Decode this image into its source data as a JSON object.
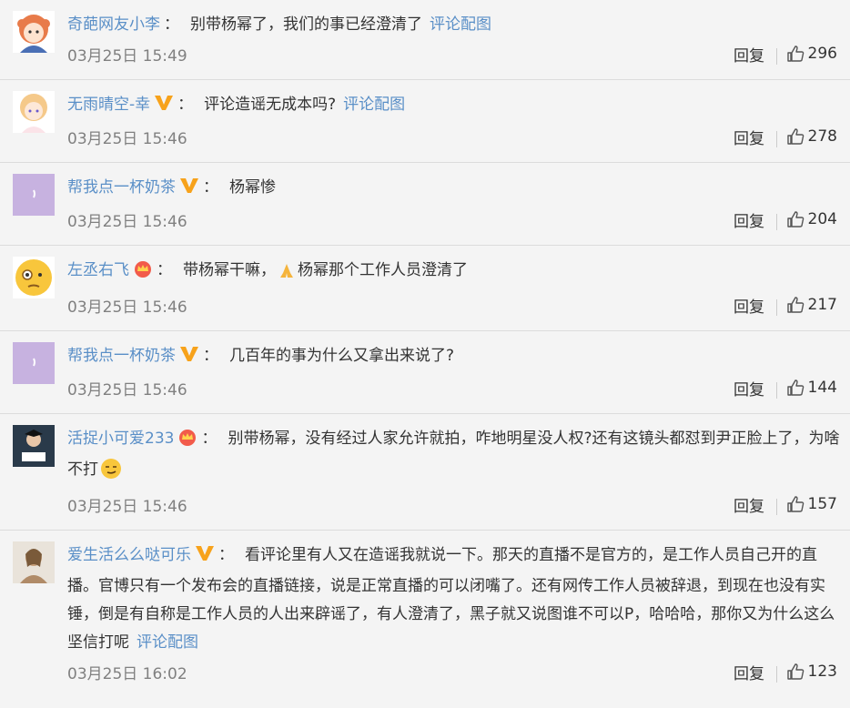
{
  "reply_label": "回复",
  "pic_link_label": "评论配图",
  "comments": [
    {
      "user": "奇葩网友小李",
      "badge": "",
      "sep": "：",
      "text": "别带杨幂了，我们的事已经澄清了",
      "has_pic_link": true,
      "time": "03月25日 15:49",
      "likes": "296"
    },
    {
      "user": "无雨晴空-幸",
      "badge": "vip",
      "sep": "：",
      "text": "评论造谣无成本吗?",
      "has_pic_link": true,
      "time": "03月25日 15:46",
      "likes": "278"
    },
    {
      "user": "帮我点一杯奶茶",
      "badge": "vip",
      "sep": "：",
      "text": "杨幂惨",
      "has_pic_link": false,
      "time": "03月25日 15:46",
      "likes": "204"
    },
    {
      "user": "左丞右飞",
      "badge": "crown",
      "sep": "：",
      "text_a": "带杨幂干嘛，",
      "text_b": "杨幂那个工作人员澄清了",
      "time": "03月25日 15:46",
      "likes": "217"
    },
    {
      "user": "帮我点一杯奶茶",
      "badge": "vip",
      "sep": "：",
      "text": "几百年的事为什么又拿出来说了?",
      "has_pic_link": false,
      "time": "03月25日 15:46",
      "likes": "144"
    },
    {
      "user": "活捉小可爱233",
      "badge": "crown",
      "sep": "：",
      "text": "别带杨幂，没有经过人家允许就拍，咋地明星没人权?还有这镜头都怼到尹正脸上了，为啥不打",
      "time": "03月25日 15:46",
      "likes": "157"
    },
    {
      "user": "爱生活么么哒可乐",
      "badge": "vip",
      "sep": "：",
      "text": "看评论里有人又在造谣我就说一下。那天的直播不是官方的，是工作人员自己开的直播。官博只有一个发布会的直播链接，说是正常直播的可以闭嘴了。还有网传工作人员被辞退，到现在也没有实锤，倒是有自称是工作人员的人出来辟谣了，有人澄清了，黑子就又说图谁不可以P，哈哈哈，那你又为什么这么坚信打呢",
      "has_pic_link": true,
      "time": "03月25日 16:02",
      "likes": "123"
    }
  ]
}
